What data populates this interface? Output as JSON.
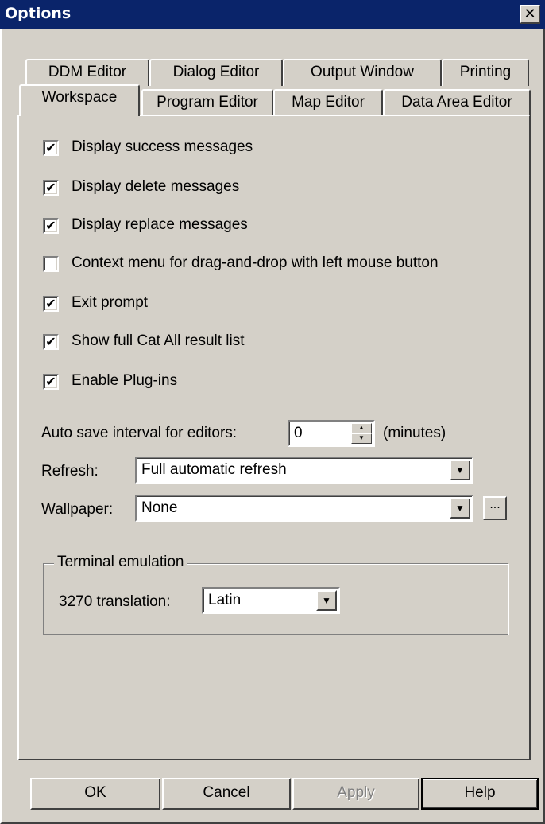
{
  "window": {
    "title": "Options",
    "close_glyph": "✕"
  },
  "tabs_row1": [
    {
      "label": "DDM Editor"
    },
    {
      "label": "Dialog Editor"
    },
    {
      "label": "Output Window"
    },
    {
      "label": "Printing"
    }
  ],
  "tabs_row2": [
    {
      "label": "Workspace",
      "active": true
    },
    {
      "label": "Program Editor"
    },
    {
      "label": "Map Editor"
    },
    {
      "label": "Data Area Editor"
    }
  ],
  "checkboxes": [
    {
      "label": "Display success messages",
      "checked": true,
      "mark": "✔"
    },
    {
      "label": "Display delete messages",
      "checked": true,
      "mark": "✔"
    },
    {
      "label": "Display replace messages",
      "checked": true,
      "mark": "✔"
    },
    {
      "label": "Context menu for drag-and-drop with left mouse button",
      "checked": false,
      "mark": ""
    },
    {
      "label": "Exit prompt",
      "checked": true,
      "mark": "✔"
    },
    {
      "label": "Show full Cat All result list",
      "checked": true,
      "mark": "✔"
    },
    {
      "label": "Enable Plug-ins",
      "checked": true,
      "mark": "✔"
    }
  ],
  "autosave": {
    "label": "Auto save interval for editors:",
    "value": "0",
    "unit": "(minutes)"
  },
  "refresh": {
    "label": "Refresh:",
    "value": "Full automatic refresh"
  },
  "wallpaper": {
    "label": "Wallpaper:",
    "value": "None",
    "browse_label": "..."
  },
  "terminal": {
    "group_title": "Terminal emulation",
    "translation_label": "3270 translation:",
    "translation_value": "Latin"
  },
  "buttons": {
    "ok": "OK",
    "cancel": "Cancel",
    "apply": "Apply",
    "help": "Help"
  },
  "icons": {
    "dropdown_arrow": "▼",
    "spin_up": "▲",
    "spin_down": "▼"
  },
  "colors": {
    "titlebar": "#0a246a",
    "face": "#d4d0c8"
  }
}
